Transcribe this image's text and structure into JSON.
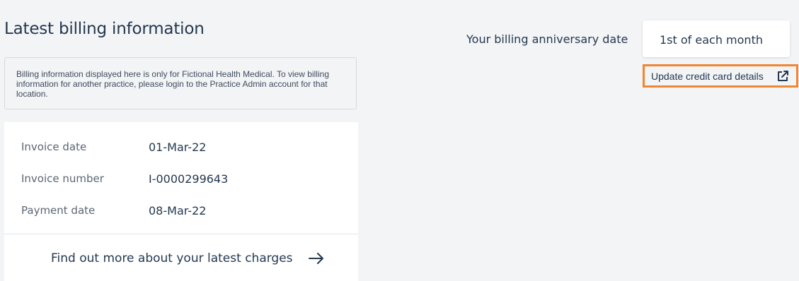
{
  "page_title": "Latest billing information",
  "notice": "Billing information displayed here is only for Fictional Health Medical. To view billing information for another practice, please login to the Practice Admin account for that location.",
  "invoice": {
    "rows": [
      {
        "label": "Invoice date",
        "value": "01-Mar-22"
      },
      {
        "label": "Invoice number",
        "value": "I-0000299643"
      },
      {
        "label": "Payment date",
        "value": "08-Mar-22"
      }
    ]
  },
  "charges_link": "Find out more about your latest charges",
  "anniversary": {
    "label": "Your billing anniversary date",
    "value": "1st of each month"
  },
  "update_cc_link": "Update credit card details",
  "colors": {
    "highlight": "#f08532",
    "text": "#24384f",
    "background": "#f3f4f6"
  }
}
